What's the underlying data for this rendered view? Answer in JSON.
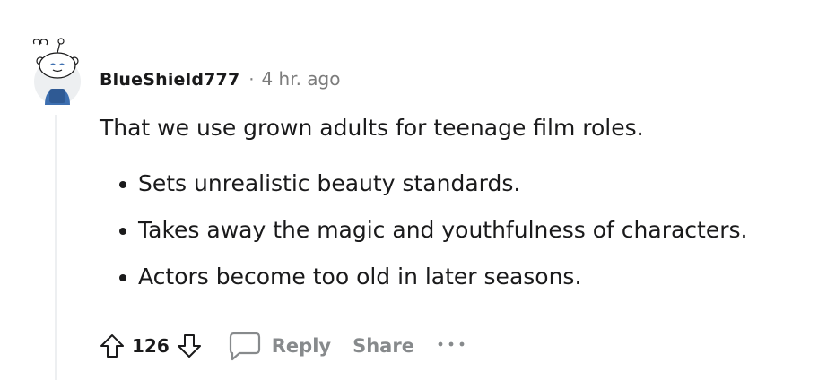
{
  "comment": {
    "username": "BlueShield777",
    "separator": "·",
    "timestamp": "4 hr. ago",
    "text": "That we use grown adults for teenage film roles.",
    "bullets": [
      "Sets unrealistic beauty standards.",
      "Takes away the magic and youthfulness of characters.",
      "Actors become too old in later seasons."
    ]
  },
  "actions": {
    "vote_count": "126",
    "reply_label": "Reply",
    "share_label": "Share",
    "upvote_icon": "arrow-up-outline-icon",
    "downvote_icon": "arrow-down-outline-icon",
    "reply_icon": "speech-bubble-icon",
    "more_icon": "ellipsis-icon"
  },
  "colors": {
    "text": "#1a1a1b",
    "muted": "#7c7c7c",
    "action_gray": "#878a8c",
    "thread_line": "#edeff1",
    "avatar_blue": "#3d6fb0"
  }
}
